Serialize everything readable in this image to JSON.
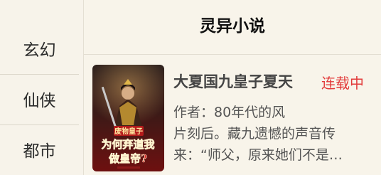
{
  "sidebar": {
    "categories": [
      {
        "label": "玄幻"
      },
      {
        "label": "仙侠"
      },
      {
        "label": "都市"
      }
    ]
  },
  "header": {
    "title": "灵异小说"
  },
  "book": {
    "title": "大夏国九皇子夏天",
    "status": "连载中",
    "author": "作者：80年代的风",
    "description": "片刻后。藏九遗憾的声音传来：“师父，原来她们不是…",
    "cover": {
      "top_text": "废物皇子",
      "main_text": "为何弃道我做皇帝?",
      "colors": {
        "bg_dark": "#1c1416",
        "bg_red": "#7a1414",
        "gold": "#e0b64a",
        "text_red": "#e12a2a",
        "banner": "#b41b1b"
      }
    }
  },
  "colors": {
    "background": "#f8f4ea",
    "status": "#e23a3a",
    "divider": "#dcd7cb"
  }
}
